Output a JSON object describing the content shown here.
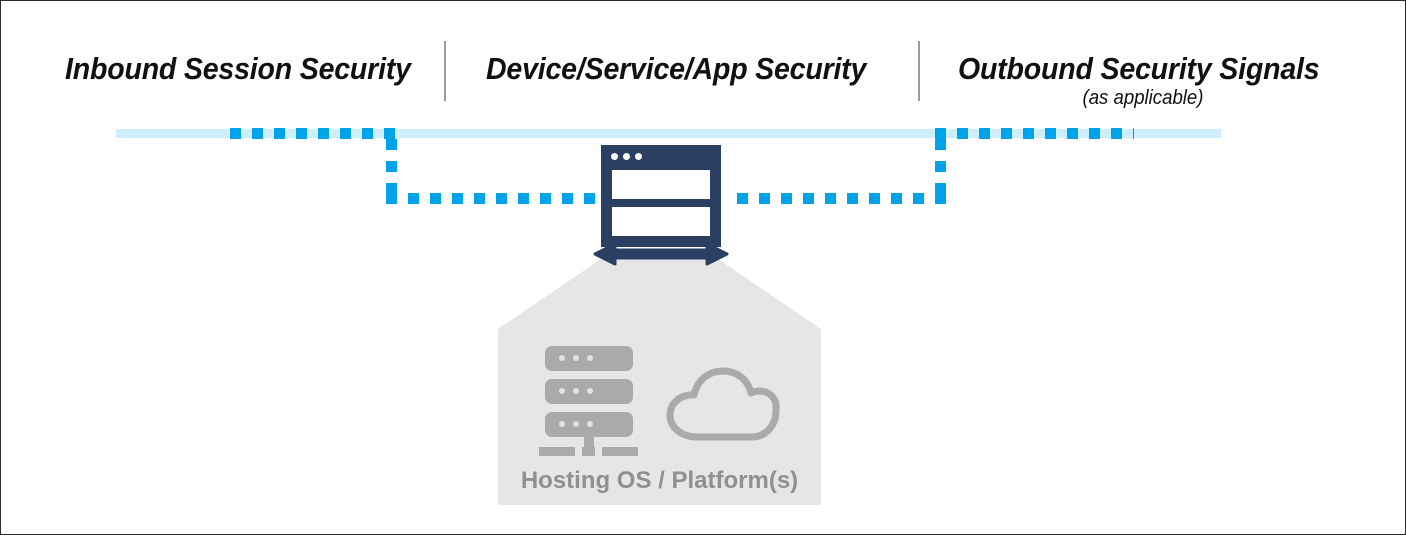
{
  "diagram": {
    "headers": [
      {
        "id": "inbound",
        "label": "Inbound Session Security"
      },
      {
        "id": "device",
        "label": "Device/Service/App Security"
      },
      {
        "id": "outbound",
        "label": "Outbound Security Signals",
        "sublabel": "(as applicable)"
      }
    ],
    "platform": {
      "label": "Hosting OS / Platform(s)",
      "icons": [
        "server-rack-icon",
        "cloud-icon"
      ]
    },
    "center": {
      "icon": "app-window-icon",
      "arrow": "double-headed-arrow-icon"
    },
    "flow": {
      "session_band": "inbound-outbound-session-band",
      "dashed_path": "security-signal-dashed-path"
    },
    "colors": {
      "accent_blue": "#00a3e8",
      "band_blue": "#cdeefc",
      "navy": "#2b3f63",
      "platform_gray": "#e6e6e6",
      "icon_gray": "#aaaaaa",
      "label_gray": "#909090",
      "divider_gray": "#9b9b9b",
      "text_black": "#111111"
    }
  }
}
